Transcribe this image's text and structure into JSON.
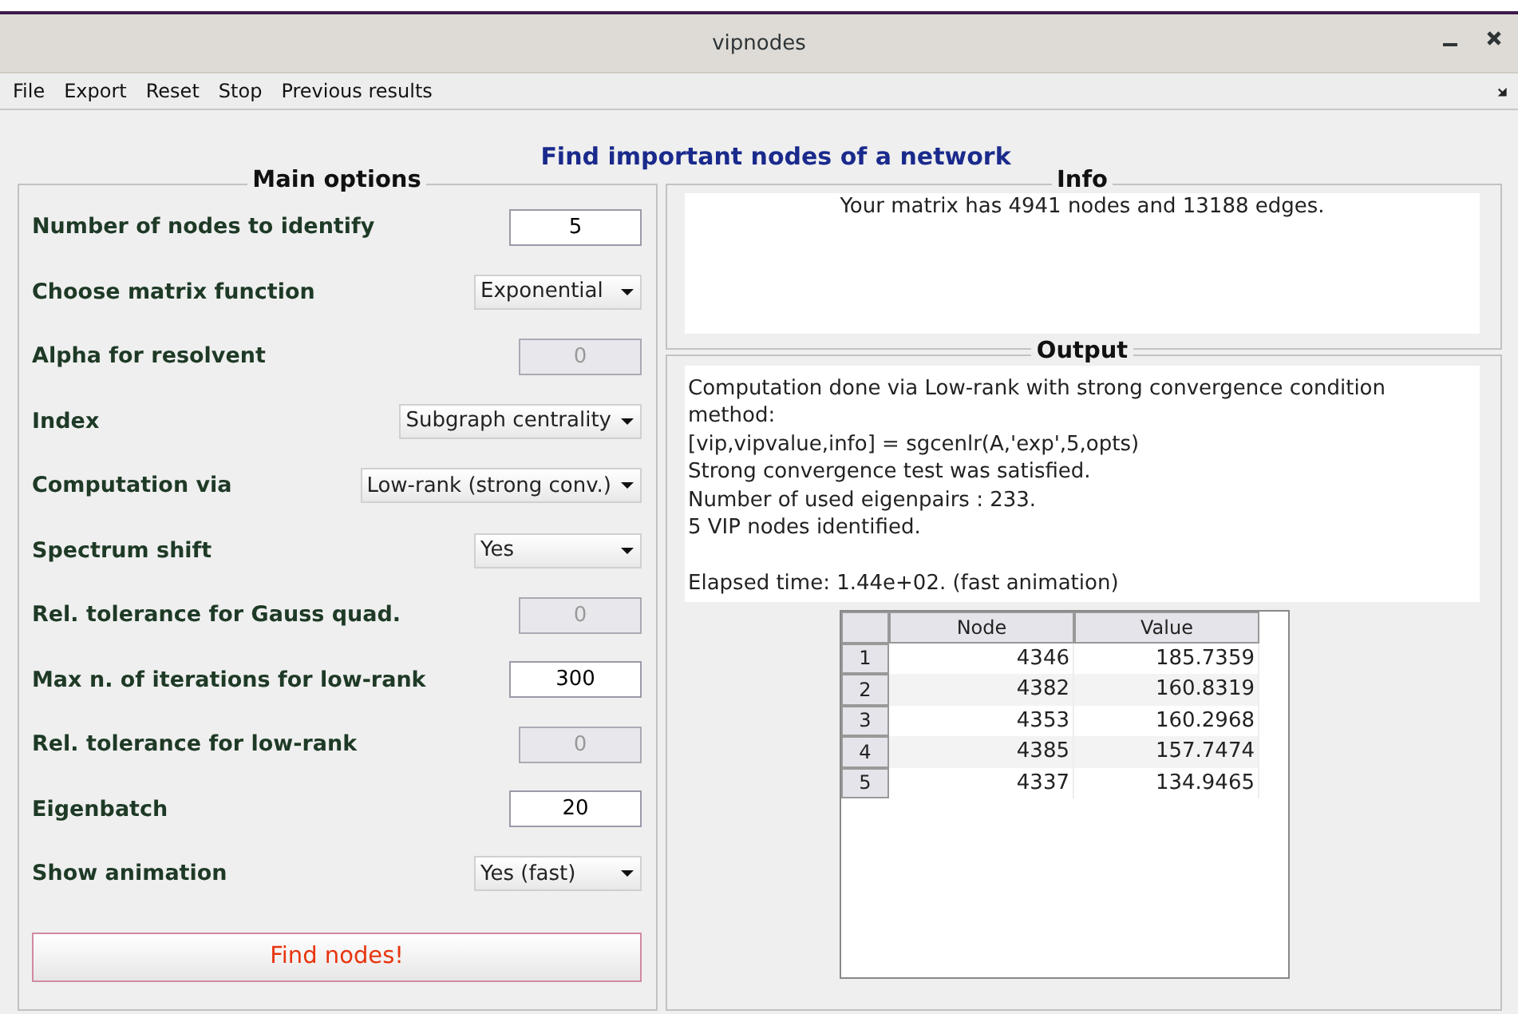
{
  "window": {
    "title": "vipnodes"
  },
  "menu": [
    "File",
    "Export",
    "Reset",
    "Stop",
    "Previous results"
  ],
  "heading": "Find important nodes of a network",
  "main_options": {
    "title": "Main options",
    "rows": [
      {
        "label": "Number of nodes to identify",
        "kind": "text",
        "value": "5",
        "disabled": false
      },
      {
        "label": "Choose matrix function",
        "kind": "dropdown",
        "value": "Exponential",
        "disabled": false
      },
      {
        "label": "Alpha for resolvent",
        "kind": "text",
        "value": "0",
        "disabled": true
      },
      {
        "label": "Index",
        "kind": "dropdown",
        "value": "Subgraph centrality",
        "disabled": false
      },
      {
        "label": "Computation via",
        "kind": "dropdown",
        "value": "Low-rank (strong conv.)",
        "disabled": false
      },
      {
        "label": "Spectrum shift",
        "kind": "dropdown",
        "value": "Yes",
        "disabled": false
      },
      {
        "label": "Rel. tolerance for Gauss quad.",
        "kind": "text",
        "value": "0",
        "disabled": true
      },
      {
        "label": "Max n. of iterations for low-rank",
        "kind": "text",
        "value": "300",
        "disabled": false
      },
      {
        "label": "Rel. tolerance for low-rank",
        "kind": "text",
        "value": "0",
        "disabled": true
      },
      {
        "label": "Eigenbatch",
        "kind": "text",
        "value": "20",
        "disabled": false
      },
      {
        "label": "Show animation",
        "kind": "dropdown",
        "value": "Yes (fast)",
        "disabled": false
      }
    ],
    "button": "Find nodes!"
  },
  "info": {
    "title": "Info",
    "text": "Your matrix has 4941 nodes and 13188 edges."
  },
  "output": {
    "title": "Output",
    "paragraphs": [
      [
        "Computation done via Low-rank with strong convergence condition method:",
        "[vip,vipvalue,info] = sgcenlr(A,'exp',5,opts)",
        "Strong convergence test was satisfied.",
        "Number of used eigenpairs : 233.",
        "5 VIP nodes identified."
      ],
      [
        "Elapsed time: 1.44e+02. (fast animation)"
      ]
    ],
    "table": {
      "columns": [
        "Node",
        "Value"
      ],
      "rows": [
        {
          "index": "1",
          "cells": [
            "4346",
            "185.7359"
          ]
        },
        {
          "index": "2",
          "cells": [
            "4382",
            "160.8319"
          ]
        },
        {
          "index": "3",
          "cells": [
            "4353",
            "160.2968"
          ]
        },
        {
          "index": "4",
          "cells": [
            "4385",
            "157.7474"
          ]
        },
        {
          "index": "5",
          "cells": [
            "4337",
            "134.9465"
          ]
        }
      ]
    }
  }
}
